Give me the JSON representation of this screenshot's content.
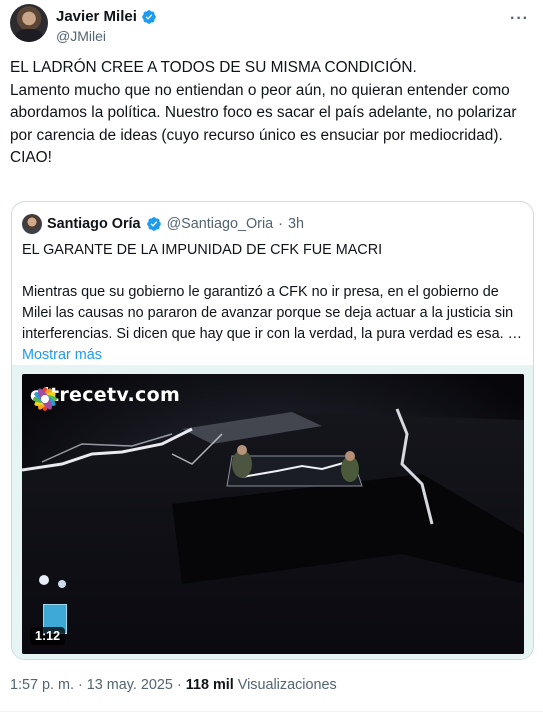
{
  "author": {
    "name": "Javier Milei",
    "handle": "@JMilei",
    "verified": true
  },
  "more_icon": "more-horizontal-icon",
  "tweet": {
    "paragraphs": [
      "EL LADRÓN CREE A TODOS DE SU MISMA CONDICIÓN.",
      "Lamento mucho que no entiendan o peor aún, no quieran entender como abordamos la política. Nuestro foco es sacar el país adelante, no polarizar por carencia de ideas (cuyo recurso único es ensuciar por mediocridad).",
      "CIAO!"
    ]
  },
  "quoted": {
    "name": "Santiago Oría",
    "handle": "@Santiago_Oria",
    "separator": "·",
    "time": "3h",
    "headline": "EL GARANTE DE LA IMPUNIDAD DE CFK FUE MACRI",
    "body": "Mientras que su gobierno le garantizó a CFK no ir presa, en el gobierno de Milei las causas no pararon de avanzar porque se deja actuar a la justicia sin interferencias. Si dicen que hay que ir con la verdad, la pura verdad es esa. …",
    "show_more": "Mostrar más",
    "video": {
      "logo_text": "eltrecetv.com",
      "duration": "1:12"
    }
  },
  "footer": {
    "time": "1:57 p. m.",
    "separator": "·",
    "date": "13 may. 2025",
    "views_count": "118 mil",
    "views_label": "Visualizaciones"
  },
  "colors": {
    "accent": "#1d9bf0",
    "text": "#0f1419",
    "secondary": "#536471"
  }
}
